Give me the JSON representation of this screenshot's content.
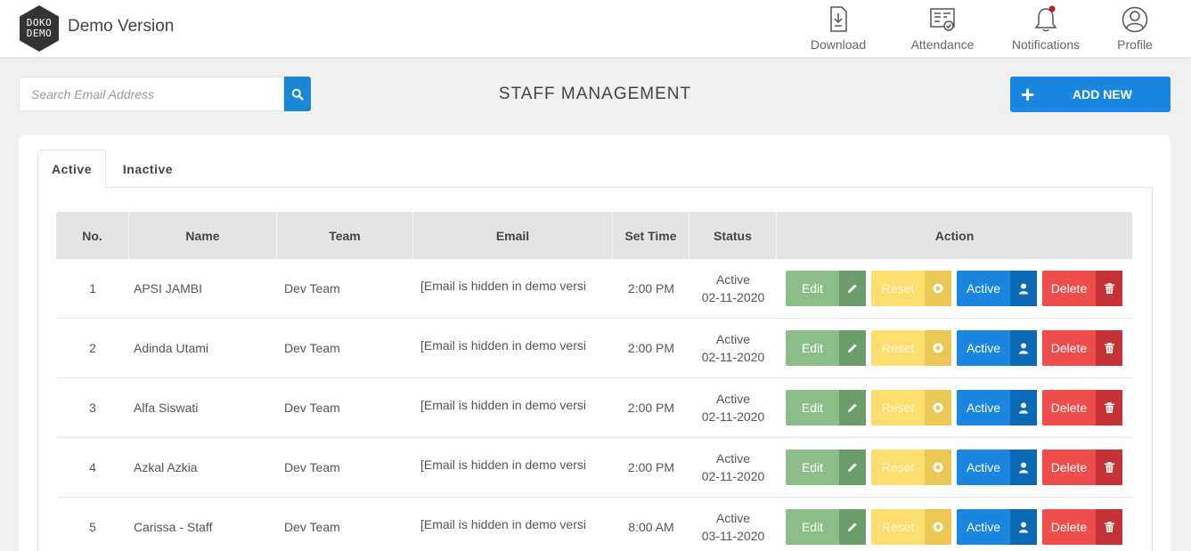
{
  "header": {
    "logo_line1": "DOKO",
    "logo_line2": "DEMO",
    "title": "Demo Version",
    "nav": [
      {
        "label": "Download",
        "icon": "download-icon"
      },
      {
        "label": "Attendance",
        "icon": "attendance-icon"
      },
      {
        "label": "Notifications",
        "icon": "bell-icon"
      },
      {
        "label": "Profile",
        "icon": "user-icon"
      }
    ],
    "notification_dot_color": "#c0161b"
  },
  "toolbar": {
    "search_placeholder": "Search Email Address",
    "page_title": "STAFF MANAGEMENT",
    "add_button_plus": "+",
    "add_button_label": "ADD NEW"
  },
  "tabs": [
    {
      "label": "Active",
      "selected": true
    },
    {
      "label": "Inactive",
      "selected": false
    }
  ],
  "table": {
    "columns": [
      "No.",
      "Name",
      "Team",
      "Email",
      "Set Time",
      "Status",
      "Action"
    ],
    "actions": {
      "edit": "Edit",
      "reset": "Reset",
      "active": "Active",
      "delete": "Delete"
    },
    "rows": [
      {
        "no": "1",
        "name": "APSI JAMBI",
        "team": "Dev Team",
        "email": "[Email is hidden in demo versi",
        "set_time": "2:00 PM",
        "status": "Active",
        "date": "02-11-2020"
      },
      {
        "no": "2",
        "name": "Adinda Utami",
        "team": "Dev Team",
        "email": "[Email is hidden in demo versi",
        "set_time": "2:00 PM",
        "status": "Active",
        "date": "02-11-2020"
      },
      {
        "no": "3",
        "name": "Alfa Siswati",
        "team": "Dev Team",
        "email": "[Email is hidden in demo versi",
        "set_time": "2:00 PM",
        "status": "Active",
        "date": "02-11-2020"
      },
      {
        "no": "4",
        "name": "Azkal Azkia",
        "team": "Dev Team",
        "email": "[Email is hidden in demo versi",
        "set_time": "2:00 PM",
        "status": "Active",
        "date": "02-11-2020"
      },
      {
        "no": "5",
        "name": "Carissa - Staff",
        "team": "Dev Team",
        "email": "[Email is hidden in demo versi",
        "set_time": "8:00 AM",
        "status": "Active",
        "date": "03-11-2020"
      }
    ]
  },
  "colors": {
    "primary": "#1a86e0",
    "edit": "#8cbf88",
    "reset": "#fede6e",
    "delete": "#ef4c4c"
  }
}
